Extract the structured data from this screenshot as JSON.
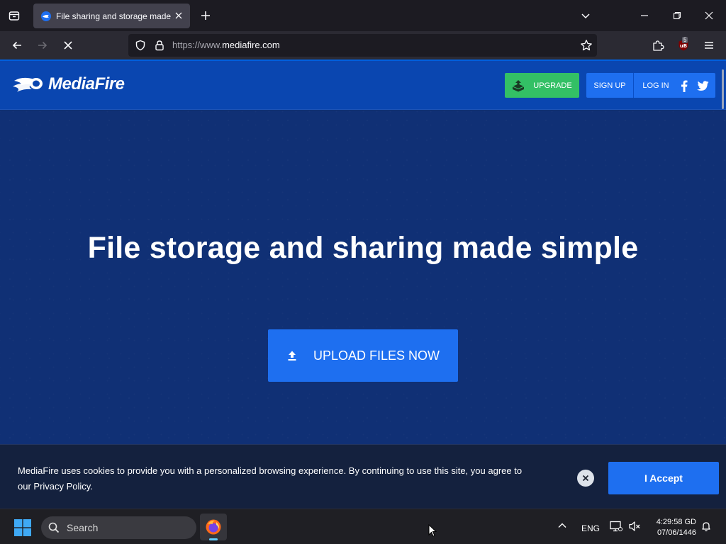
{
  "browser": {
    "tab": {
      "title": "File sharing and storage made simple"
    },
    "url_prefix": "https://www.",
    "url_domain": "mediafire.com",
    "extension_badge": "5"
  },
  "site": {
    "logo_text": "MediaFire",
    "nav": {
      "upgrade": "UPGRADE",
      "sign_up": "SIGN UP",
      "log_in": "LOG IN"
    },
    "headline": "File storage and sharing made simple",
    "upload_button": "UPLOAD FILES NOW",
    "cookie": {
      "message": "MediaFire uses cookies to provide you with a personalized browsing experience. By continuing to use this site, you agree to our Privacy Policy.",
      "accept": "I Accept"
    }
  },
  "taskbar": {
    "search_placeholder": "Search",
    "language": "ENG",
    "time": "4:29:58 GD",
    "date": "07/06/1446"
  },
  "colors": {
    "header_blue": "#0a46b0",
    "hero_blue": "#103075",
    "button_blue": "#1e6ff0",
    "upgrade_green": "#33c065",
    "cookie_bg": "#14213e"
  }
}
